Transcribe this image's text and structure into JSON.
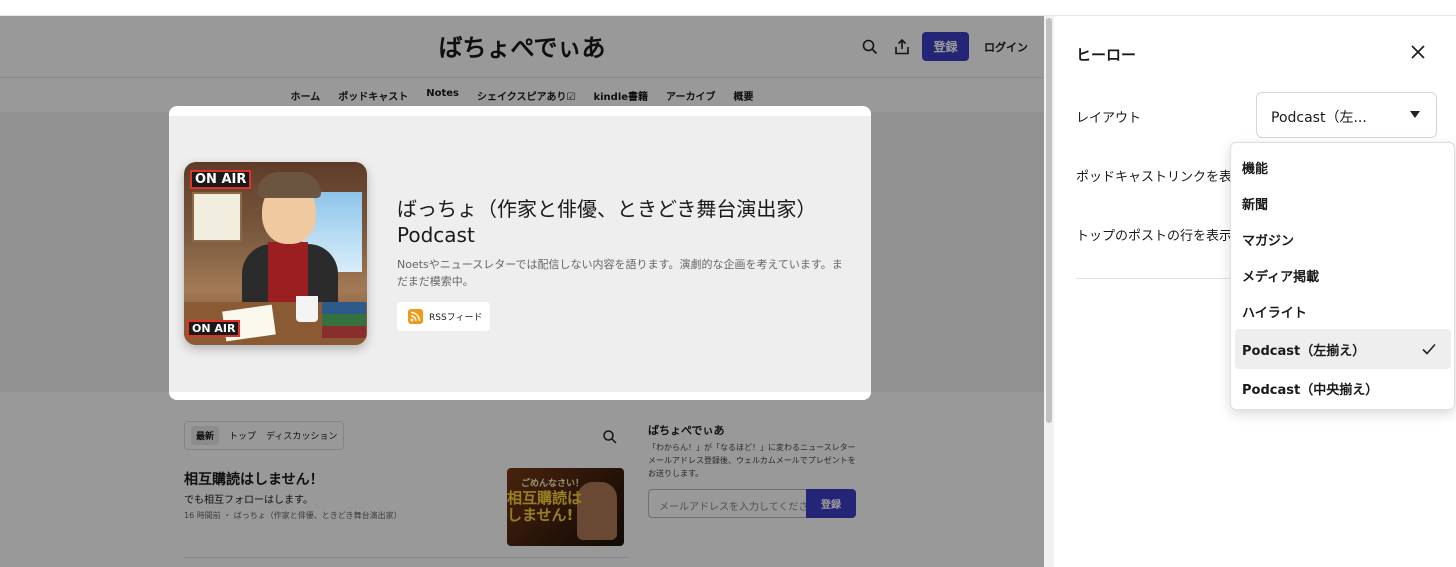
{
  "site": {
    "title": "ばちょぺでぃあ",
    "register_label": "登録",
    "login_label": "ログイン",
    "nav": [
      "ホーム",
      "ポッドキャスト",
      "Notes",
      "シェイクスピアあり☑",
      "kindle書籍",
      "アーカイブ",
      "概要"
    ]
  },
  "hero": {
    "podcast_title": "ばっちょ（作家と俳優、ときどき舞台演出家） Podcast",
    "description": "Noetsやニュースレターでは配信しない内容を語ります。演劇的な企画を考えています。まだまだ模索中。",
    "rss_label": "RSSフィード",
    "cover_text_top": "ON AIR",
    "cover_text_bottom": "ON AIR"
  },
  "posts": {
    "tabs": [
      "最新",
      "トップ",
      "ディスカッション"
    ],
    "active_tab": "最新",
    "items": [
      {
        "title": "相互購読はしません！",
        "subtitle": "でも相互フォローはします。",
        "meta": "16 時間前 ・ ばっちょ（作家と俳優、ときどき舞台演出家）",
        "thumb_line1": "ごめんなさい！",
        "thumb_line2": "相互購読は しません!"
      }
    ]
  },
  "sidebar": {
    "name": "ばちょぺでぃあ",
    "description": "「わからん！」が「なるほど！」に変わるニュースレター メールアドレス登録後、ウェルカムメールでプレゼントをお送りします。",
    "email_placeholder": "メールアドレスを入力してください...",
    "subscribe_label": "登録"
  },
  "panel": {
    "title": "ヒーロー",
    "layout_label": "レイアウト",
    "layout_value": "Podcast（左...",
    "podcast_link_label": "ポッドキャストリンクを表示",
    "top_posts_label": "トップのポストの行を表示",
    "options": [
      "機能",
      "新聞",
      "マガジン",
      "メディア掲載",
      "ハイライト",
      "Podcast（左揃え）",
      "Podcast（中央揃え）"
    ],
    "selected_option": "Podcast（左揃え）"
  },
  "colors": {
    "accent": "#3e3ec9",
    "rss": "#f29a18"
  }
}
